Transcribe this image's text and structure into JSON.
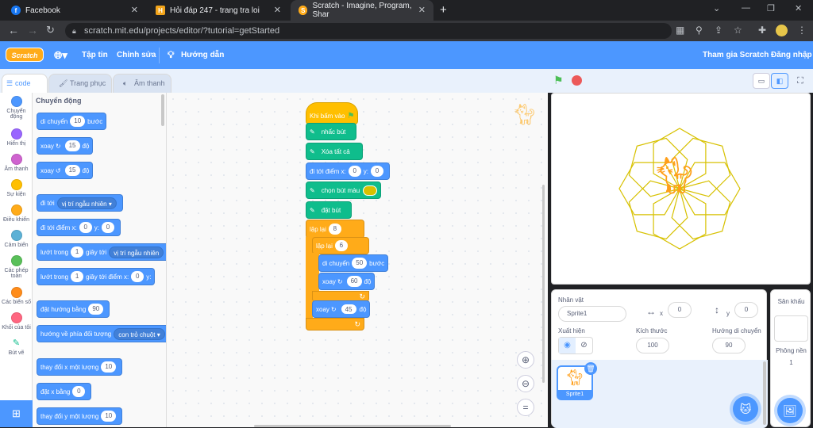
{
  "browser": {
    "tabs": [
      {
        "title": "Facebook",
        "icon": "facebook-icon"
      },
      {
        "title": "Hỏi đáp 247 - trang tra loi",
        "icon": "h-icon"
      },
      {
        "title": "Scratch - Imagine, Program, Shar",
        "icon": "scratch-icon"
      }
    ],
    "url": "scratch.mit.edu/projects/editor/?tutorial=getStarted"
  },
  "menubar": {
    "logo": "Scratch",
    "file": "Tập tin",
    "edit": "Chỉnh sửa",
    "tutorials": "Hướng dẫn",
    "join": "Tham gia Scratch",
    "signin": "Đăng nhập"
  },
  "editor_tabs": {
    "code": "code",
    "costumes": "Trang phục",
    "sounds": "Âm thanh"
  },
  "categories": [
    {
      "label": "Chuyển động",
      "color": "#4c97ff"
    },
    {
      "label": "Hiển thị",
      "color": "#9966ff"
    },
    {
      "label": "Âm thanh",
      "color": "#cf63cf"
    },
    {
      "label": "Sự kiện",
      "color": "#ffbf00"
    },
    {
      "label": "Điều khiển",
      "color": "#ffab19"
    },
    {
      "label": "Cảm biến",
      "color": "#5cb1d6"
    },
    {
      "label": "Các phép toán",
      "color": "#59c059"
    },
    {
      "label": "Các biến số",
      "color": "#ff8c1a"
    },
    {
      "label": "Khối của tôi",
      "color": "#ff6680"
    },
    {
      "label": "Bút vẽ",
      "color": "#0fbd8c"
    }
  ],
  "palette": {
    "heading": "Chuyển động",
    "move": {
      "a": "di chuyển",
      "v": "10",
      "b": "bước"
    },
    "turn_right": {
      "a": "xoay",
      "v": "15",
      "b": "độ"
    },
    "turn_left": {
      "a": "xoay",
      "v": "15",
      "b": "độ"
    },
    "goto": {
      "a": "đi tới",
      "dd": "vị trí ngẫu nhiên"
    },
    "goto_xy": {
      "a": "đi tới điểm x:",
      "x": "0",
      "b": "y:",
      "y": "0"
    },
    "glide": {
      "a": "lướt trong",
      "v": "1",
      "b": "giây tới",
      "dd": "vị trí ngẫu nhiên"
    },
    "glide_xy": {
      "a": "lướt trong",
      "v": "1",
      "b": "giây tới điểm x:",
      "x": "0",
      "c": "y:"
    },
    "point": {
      "a": "đặt hướng bằng",
      "v": "90"
    },
    "point_towards": {
      "a": "hướng về phía đối tượng",
      "dd": "con trỏ chuột"
    },
    "change_x": {
      "a": "thay đổi x một lượng",
      "v": "10"
    },
    "set_x": {
      "a": "đặt x bằng",
      "v": "0"
    },
    "change_y": {
      "a": "thay đổi y một lượng",
      "v": "10"
    }
  },
  "script": {
    "hat": "Khi bấm vào",
    "pen_clear_label": "nhấc bút",
    "erase": "Xóa tất cả",
    "goto": {
      "a": "đi tới điểm x:",
      "x": "0",
      "b": "y:",
      "y": "0"
    },
    "pen_color": "chọn bút màu",
    "pen_down": "đặt bút",
    "repeat1": {
      "a": "lặp lại",
      "v": "8"
    },
    "repeat2": {
      "a": "lặp lại",
      "v": "6"
    },
    "move": {
      "a": "di chuyển",
      "v": "50",
      "b": "bước"
    },
    "turn": {
      "a": "xoay",
      "v": "60",
      "b": "độ"
    },
    "turn2": {
      "a": "xoay",
      "v": "45",
      "b": "độ"
    }
  },
  "sprite_info": {
    "sprite_label": "Nhân vật",
    "sprite_name": "Sprite1",
    "x_label": "x",
    "x": "0",
    "y_label": "y",
    "y": "0",
    "show_label": "Xuất hiện",
    "size_label": "Kích thước",
    "size": "100",
    "direction_label": "Hướng di chuyển",
    "direction": "90",
    "thumb_name": "Sprite1"
  },
  "stage_pane": {
    "title": "Sân khấu",
    "backdrops_label": "Phông nền",
    "backdrops": "1"
  }
}
